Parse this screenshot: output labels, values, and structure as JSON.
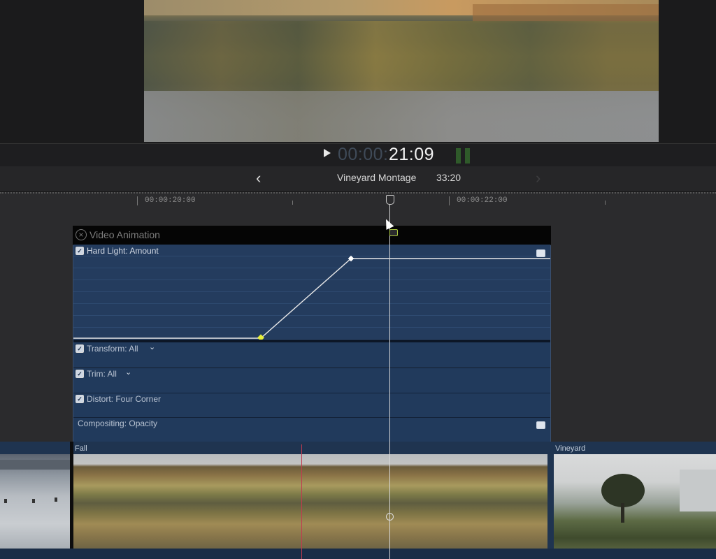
{
  "transport": {
    "timecode_dim": "00:00:",
    "timecode_bright": "21:09",
    "play_icon": "play-icon"
  },
  "header": {
    "project_name": "Vineyard Montage",
    "duration": "33:20",
    "back_icon": "chevron-left-icon",
    "forward_icon": "chevron-right-icon"
  },
  "ruler": {
    "labels": [
      "00:00:20:00",
      "00:00:22:00"
    ]
  },
  "animation_editor": {
    "title": "Video Animation",
    "params": [
      {
        "label": "Hard Light: Amount",
        "checked": true
      },
      {
        "label": "Transform: All",
        "checked": true,
        "has_dropdown": true
      },
      {
        "label": "Trim: All",
        "checked": true,
        "has_dropdown": true
      },
      {
        "label": "Distort: Four Corner",
        "checked": true
      },
      {
        "label": "Compositing: Opacity",
        "checked": false
      }
    ],
    "keyframe_colors": {
      "active": "#e7ef3a",
      "normal": "#ffffff"
    }
  },
  "clips": [
    {
      "name": "Fall"
    },
    {
      "name": "Vineyard"
    }
  ],
  "colors": {
    "panel_blue": "#203450",
    "playhead": "#d8d8d8",
    "marker_red": "#c23a4f"
  }
}
